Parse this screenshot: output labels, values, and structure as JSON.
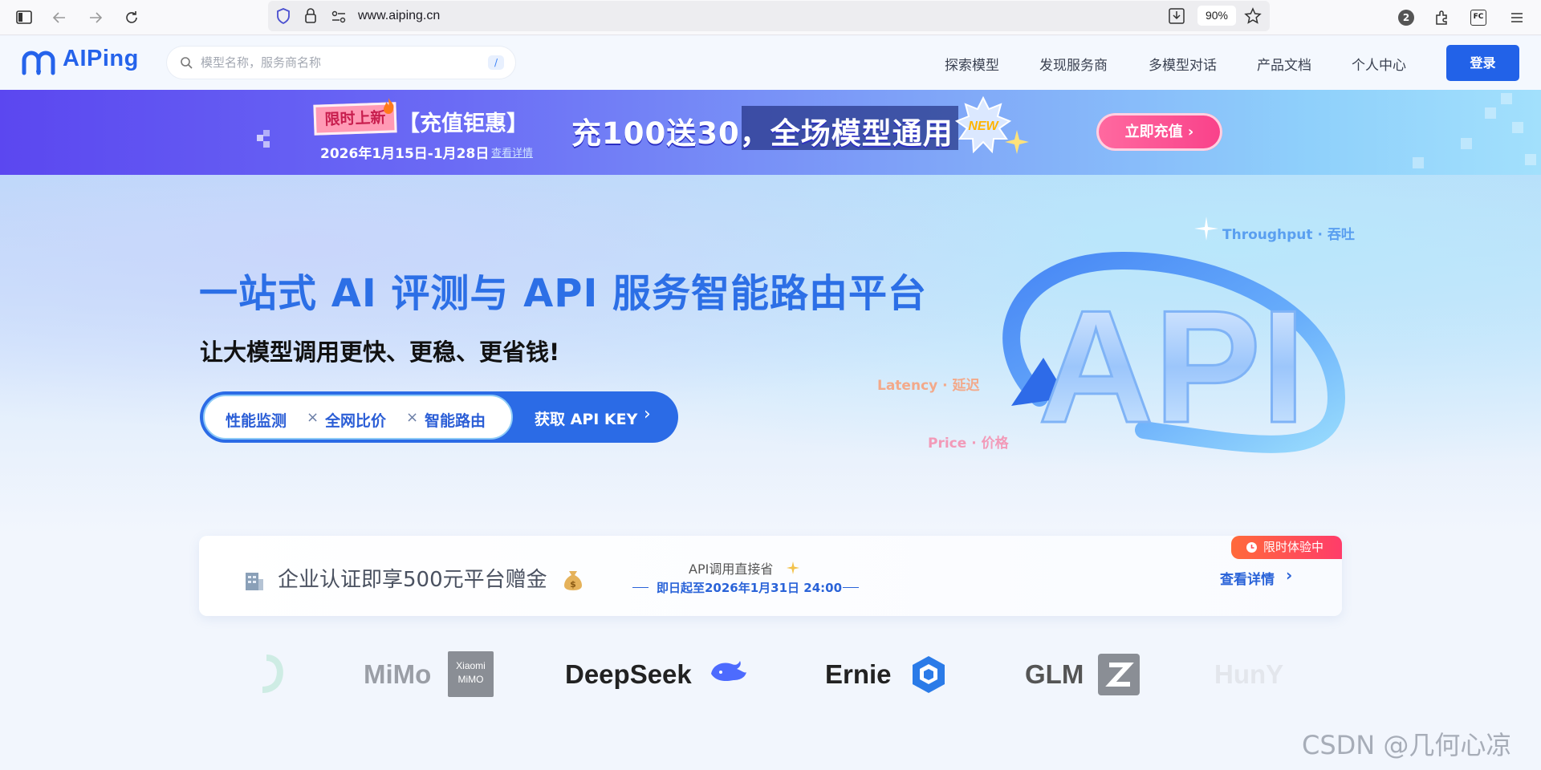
{
  "browser": {
    "url": "www.aiping.cn",
    "zoom": "90%",
    "notification_count": "2",
    "ext_label": "FC"
  },
  "header": {
    "logo": "AIPing",
    "search_placeholder": "模型名称，服务商名称",
    "search_shortcut": "/",
    "nav": [
      "探索模型",
      "发现服务商",
      "多模型对话",
      "产品文档",
      "个人中心"
    ],
    "login": "登录"
  },
  "banner": {
    "tag": "限时上新",
    "title": "【充值钜惠】",
    "date": "2026年1月15日-1月28日",
    "detail_link": "查看详情",
    "main": "充100送30，全场模型通用",
    "new_badge": "NEW",
    "cta": "立即充值"
  },
  "hero": {
    "title": "一站式 AI 评测与 API 服务智能路由平台",
    "subtitle": "让大模型调用更快、更稳、更省钱!",
    "pills": [
      "性能监测",
      "全网比价",
      "智能路由"
    ],
    "pill_sep": "×",
    "cta": "获取 API KEY",
    "api_word": "API",
    "labels": {
      "throughput": "Throughput · 吞吐",
      "latency": "Latency · 延迟",
      "price": "Price · 价格"
    }
  },
  "promo_card": {
    "title": "企业认证即享500元平台赠金",
    "mid_line1": "API调用直接省",
    "mid_line2": "即日起至2026年1月31日 24:00",
    "link": "查看详情",
    "badge": "限时体验中"
  },
  "brands": {
    "mimo": "MiMo",
    "mimo_logo_line1": "Xiaomi",
    "mimo_logo_line2": "MiMO",
    "deepseek": "DeepSeek",
    "ernie": "Ernie",
    "glm": "GLM",
    "hunyuan": "HunY"
  },
  "watermark": "CSDN @几何心凉"
}
